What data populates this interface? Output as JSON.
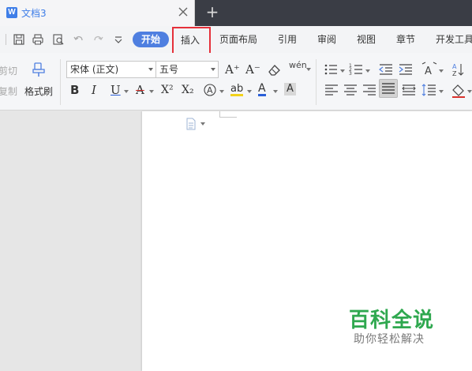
{
  "window": {
    "doc_tab_title": "文档3",
    "doc_icon_letter": "W",
    "new_tab_symbol": "+"
  },
  "menu": {
    "start": "开始",
    "insert": "插入",
    "page_layout": "页面布局",
    "references": "引用",
    "review": "审阅",
    "view": "视图",
    "sections": "章节",
    "developer": "开发工具"
  },
  "ribbon": {
    "cut": "剪切",
    "copy": "复制",
    "format_painter": "格式刷",
    "font_name": "宋体 (正文)",
    "font_size": "五号",
    "bold": "B",
    "italic": "I",
    "underline": "U",
    "strike": "A",
    "superscript": "X²",
    "subscript": "X₂",
    "grow_font": "A⁺",
    "shrink_font": "A⁻",
    "pinyin": "wén",
    "font_color_letter": "A",
    "char_shading_letter": "A",
    "highlight_label": "ab"
  },
  "colors": {
    "accent": "#4f7fe0",
    "highlight_box": "#e5303a",
    "font_color_bar": "#2a5fd8",
    "highlight_bar": "#f2d21a",
    "strike_color": "#d9312c",
    "watermark_green": "#2fa84f"
  },
  "watermark": {
    "title": "百科全说",
    "subtitle": "助你轻松解决"
  }
}
